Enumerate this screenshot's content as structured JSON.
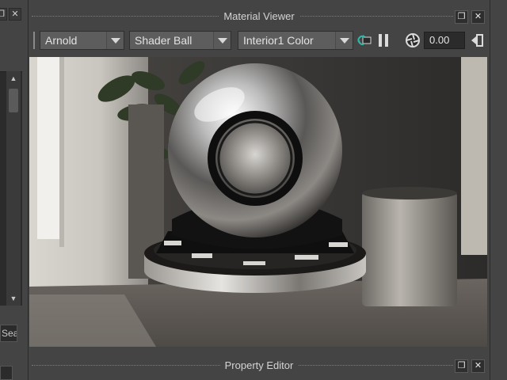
{
  "left_panel": {
    "search_text": "Sea",
    "restore_icon": "restore-icon",
    "close_icon": "close-icon"
  },
  "material_viewer": {
    "title": "Material Viewer",
    "renderer": "Arnold",
    "geometry": "Shader Ball",
    "environment": "Interior1 Color",
    "exposure": "0.00",
    "icons": [
      "refresh-render-icon",
      "pause-icon",
      "aperture-icon",
      "export-icon"
    ]
  },
  "property_editor": {
    "title": "Property Editor"
  },
  "colors": {
    "panel": "#444444",
    "field": "#2b2b2b",
    "dropdown": "#5d5d5d",
    "accent": "#2fb8a8"
  }
}
